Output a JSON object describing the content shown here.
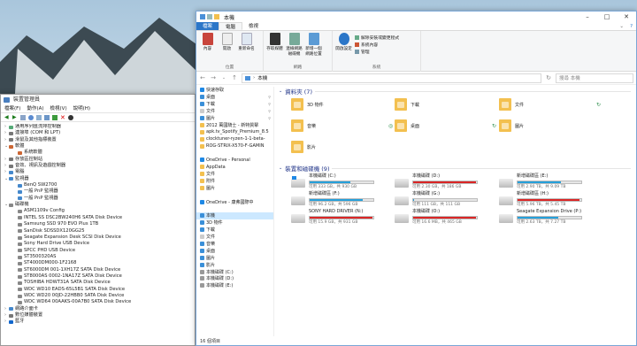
{
  "colors": {
    "accent": "#2b76c8",
    "bar_blue": "#26a0da",
    "bar_red": "#da2626",
    "selection": "#cce8ff"
  },
  "device_manager": {
    "title": "裝置管理員",
    "menu": [
      "檔案(F)",
      "動作(A)",
      "檢視(V)",
      "說明(H)"
    ],
    "tree": [
      {
        "label": "通用序列匯流排控制器",
        "indent": 0,
        "exp": ">",
        "color": "#5a7"
      },
      {
        "label": "連接埠 (COM 和 LPT)",
        "indent": 0,
        "exp": ">",
        "color": "#777"
      },
      {
        "label": "滑鼠及其他指標裝置",
        "indent": 0,
        "exp": ">",
        "color": "#777"
      },
      {
        "label": "軟體",
        "indent": 0,
        "exp": "v",
        "color": "#c63"
      },
      {
        "label": "系統軟體",
        "indent": 1,
        "exp": "",
        "color": "#c63"
      },
      {
        "label": "存放區控制站",
        "indent": 0,
        "exp": ">",
        "color": "#777"
      },
      {
        "label": "音效、視訊及遊戲控制器",
        "indent": 0,
        "exp": ">",
        "color": "#777"
      },
      {
        "label": "電腦",
        "indent": 0,
        "exp": ">",
        "color": "#48c"
      },
      {
        "label": "監視器",
        "indent": 0,
        "exp": "v",
        "color": "#48c"
      },
      {
        "label": "BenQ SW2700",
        "indent": 1,
        "exp": "",
        "color": "#48c"
      },
      {
        "label": "一般 PnP 監視器",
        "indent": 1,
        "exp": "",
        "color": "#48c"
      },
      {
        "label": "一般 PnP 監視器",
        "indent": 1,
        "exp": "",
        "color": "#48c"
      },
      {
        "label": "磁碟機",
        "indent": 0,
        "exp": "v",
        "color": "#888"
      },
      {
        "label": "ASM1109v Config",
        "indent": 1,
        "exp": "",
        "color": "#888"
      },
      {
        "label": "INTEL SS DSC2BW240H6 SATA Disk Device",
        "indent": 1,
        "exp": "",
        "color": "#888"
      },
      {
        "label": "Samsung SSD 970 EVO Plus 1TB",
        "indent": 1,
        "exp": "",
        "color": "#888"
      },
      {
        "label": "SanDisk SDSSDX120GG25",
        "indent": 1,
        "exp": "",
        "color": "#888"
      },
      {
        "label": "Seagate Expansion Desk SCSI Disk Device",
        "indent": 1,
        "exp": "",
        "color": "#888"
      },
      {
        "label": "Sony Hard Drive USB Device",
        "indent": 1,
        "exp": "",
        "color": "#888"
      },
      {
        "label": "SPCC PHD USB Device",
        "indent": 1,
        "exp": "",
        "color": "#888"
      },
      {
        "label": "ST3500320AS",
        "indent": 1,
        "exp": "",
        "color": "#888"
      },
      {
        "label": "ST4000DM000-1F2168",
        "indent": 1,
        "exp": "",
        "color": "#888"
      },
      {
        "label": "ST6000DM 001-1XH17Z SATA Disk Device",
        "indent": 1,
        "exp": "",
        "color": "#888"
      },
      {
        "label": "ST8000AS 0002-1NA17Z SATA Disk Device",
        "indent": 1,
        "exp": "",
        "color": "#888"
      },
      {
        "label": "TOSHIBA HDWT31A SATA Disk Device",
        "indent": 1,
        "exp": "",
        "color": "#888"
      },
      {
        "label": "WDC WD10 EADS-65L5B1 SATA Disk Device",
        "indent": 1,
        "exp": "",
        "color": "#888"
      },
      {
        "label": "WDC WD20 00JD-22HBB0 SATA Disk Device",
        "indent": 1,
        "exp": "",
        "color": "#888"
      },
      {
        "label": "WDC WD64 00AAKS-00A7B0 SATA Disk Device",
        "indent": 1,
        "exp": "",
        "color": "#888"
      },
      {
        "label": "網路介面卡",
        "indent": 0,
        "exp": ">",
        "color": "#48c"
      },
      {
        "label": "數位媒體裝置",
        "indent": 0,
        "exp": ">",
        "color": "#777"
      },
      {
        "label": "藍牙",
        "indent": 0,
        "exp": ">",
        "color": "#16c"
      }
    ]
  },
  "explorer": {
    "title": "本機",
    "tabs": [
      "檔案",
      "電腦",
      "檢視"
    ],
    "ribbon": {
      "groups": [
        {
          "label": "位置",
          "buttons": [
            "內容",
            "開啟",
            "重新命名"
          ]
        },
        {
          "label": "網路",
          "buttons": [
            "存取媒體",
            "連線網路磁碟機",
            "新增一個網路位置"
          ]
        },
        {
          "label": "系統",
          "buttons": [
            "開啟設定"
          ],
          "small": [
            "解除安裝或變更程式",
            "系統內容",
            "管理"
          ]
        }
      ]
    },
    "address": {
      "path": "本機",
      "search_placeholder": "搜尋 本機"
    },
    "nav": [
      {
        "label": "快速存取",
        "c": "#1e88e5",
        "pin": false
      },
      {
        "label": "桌面",
        "c": "#3a8fd8",
        "pin": true
      },
      {
        "label": "下載",
        "c": "#3a8fd8",
        "pin": true
      },
      {
        "label": "文件",
        "c": "#ccc",
        "pin": true
      },
      {
        "label": "圖片",
        "c": "#3a8fd8",
        "pin": true
      },
      {
        "label": "2012 萬國騎士 - 新特質擊",
        "c": "#f3c04f",
        "pin": false
      },
      {
        "label": "apk.tv_Spotify_Premium_8.5",
        "c": "#f3c04f",
        "pin": false
      },
      {
        "label": "clocktuner-ryzen-1-1-beta-",
        "c": "#f3c04f",
        "pin": false
      },
      {
        "label": "ROG-STRIX-X570-F-GAMIN",
        "c": "#f3c04f",
        "pin": false
      },
      {
        "label": "",
        "c": "transparent",
        "pin": false
      },
      {
        "label": "OneDrive - Personal",
        "c": "#1e88e5",
        "pin": false
      },
      {
        "label": "AppData",
        "c": "#f3c04f",
        "pin": false
      },
      {
        "label": "文件",
        "c": "#f3c04f",
        "pin": false
      },
      {
        "label": "附件",
        "c": "#f3c04f",
        "pin": false
      },
      {
        "label": "圖片",
        "c": "#f3c04f",
        "pin": false
      },
      {
        "label": "",
        "c": "transparent",
        "pin": false
      },
      {
        "label": "OneDrive - 康弗國際中",
        "c": "#1e88e5",
        "pin": false
      },
      {
        "label": "",
        "c": "transparent",
        "pin": false
      },
      {
        "label": "本機",
        "c": "#3a8fd8",
        "pin": false,
        "sel": true
      },
      {
        "label": "3D 物件",
        "c": "#3a8fd8",
        "pin": false
      },
      {
        "label": "下載",
        "c": "#3a8fd8",
        "pin": false
      },
      {
        "label": "文件",
        "c": "#ccc",
        "pin": false
      },
      {
        "label": "音樂",
        "c": "#3a8fd8",
        "pin": false
      },
      {
        "label": "桌面",
        "c": "#3a8fd8",
        "pin": false
      },
      {
        "label": "圖片",
        "c": "#3a8fd8",
        "pin": false
      },
      {
        "label": "影片",
        "c": "#3a8fd8",
        "pin": false
      },
      {
        "label": "本機磁碟 (C:)",
        "c": "#999",
        "pin": false
      },
      {
        "label": "本機磁碟 (D:)",
        "c": "#999",
        "pin": false
      },
      {
        "label": "本機磁碟 (E:)",
        "c": "#999",
        "pin": false
      }
    ],
    "folders_header": "資料夾 (7)",
    "folders": [
      {
        "name": "3D 物件",
        "col": 0,
        "row": 0,
        "sync": ""
      },
      {
        "name": "下載",
        "col": 1,
        "row": 0,
        "sync": ""
      },
      {
        "name": "文件",
        "col": 2,
        "row": 0,
        "sync": "↻"
      },
      {
        "name": "音樂",
        "col": 0,
        "row": 1,
        "sync": "◎"
      },
      {
        "name": "桌面",
        "col": 1,
        "row": 1,
        "sync": "↻"
      },
      {
        "name": "圖片",
        "col": 2,
        "row": 1,
        "sync": ""
      },
      {
        "name": "影片",
        "col": 0,
        "row": 2,
        "sync": ""
      }
    ],
    "drives_header": "裝置和磁碟機 (9)",
    "drives": [
      {
        "name": "本機磁碟 (C:)",
        "info": "可用 333 GB，共 930 GB",
        "pct": 64,
        "red": false,
        "win": true,
        "col": 0,
        "row": 0
      },
      {
        "name": "本機磁碟 (D:)",
        "info": "可用 2.30 GB，共 186 GB",
        "pct": 98,
        "red": true,
        "win": false,
        "col": 1,
        "row": 0
      },
      {
        "name": "新增磁碟區 (E:)",
        "info": "可用 2.90 TB，共 9.09 TB",
        "pct": 68,
        "red": false,
        "win": false,
        "col": 2,
        "row": 0
      },
      {
        "name": "新增磁碟區 (F:)",
        "info": "可用 96.2 GB，共 596 GB",
        "pct": 84,
        "red": false,
        "win": false,
        "col": 0,
        "row": 1
      },
      {
        "name": "本機磁碟 (G:)",
        "info": "可用 111 GB，共 111 GB",
        "pct": 2,
        "red": false,
        "win": false,
        "col": 1,
        "row": 1
      },
      {
        "name": "新增磁碟區 (H:)",
        "info": "可用 5.96 TB，共 5.45 TB",
        "pct": 97,
        "red": true,
        "win": false,
        "col": 2,
        "row": 1
      },
      {
        "name": "SONY HARD DRIVER (N:)",
        "info": "可用 15.9 GB，共 931 GB",
        "pct": 98,
        "red": true,
        "win": false,
        "col": 0,
        "row": 2
      },
      {
        "name": "本機磁碟 (O:)",
        "info": "可用 16.6 MB，共 465 GB",
        "pct": 99,
        "red": true,
        "win": false,
        "col": 1,
        "row": 2
      },
      {
        "name": "Seagate Expansion Drive (P:)",
        "info": "可用 2.63 TB，共 7.27 TB",
        "pct": 64,
        "red": false,
        "win": false,
        "col": 2,
        "row": 2
      }
    ],
    "status": "16 個項目"
  }
}
